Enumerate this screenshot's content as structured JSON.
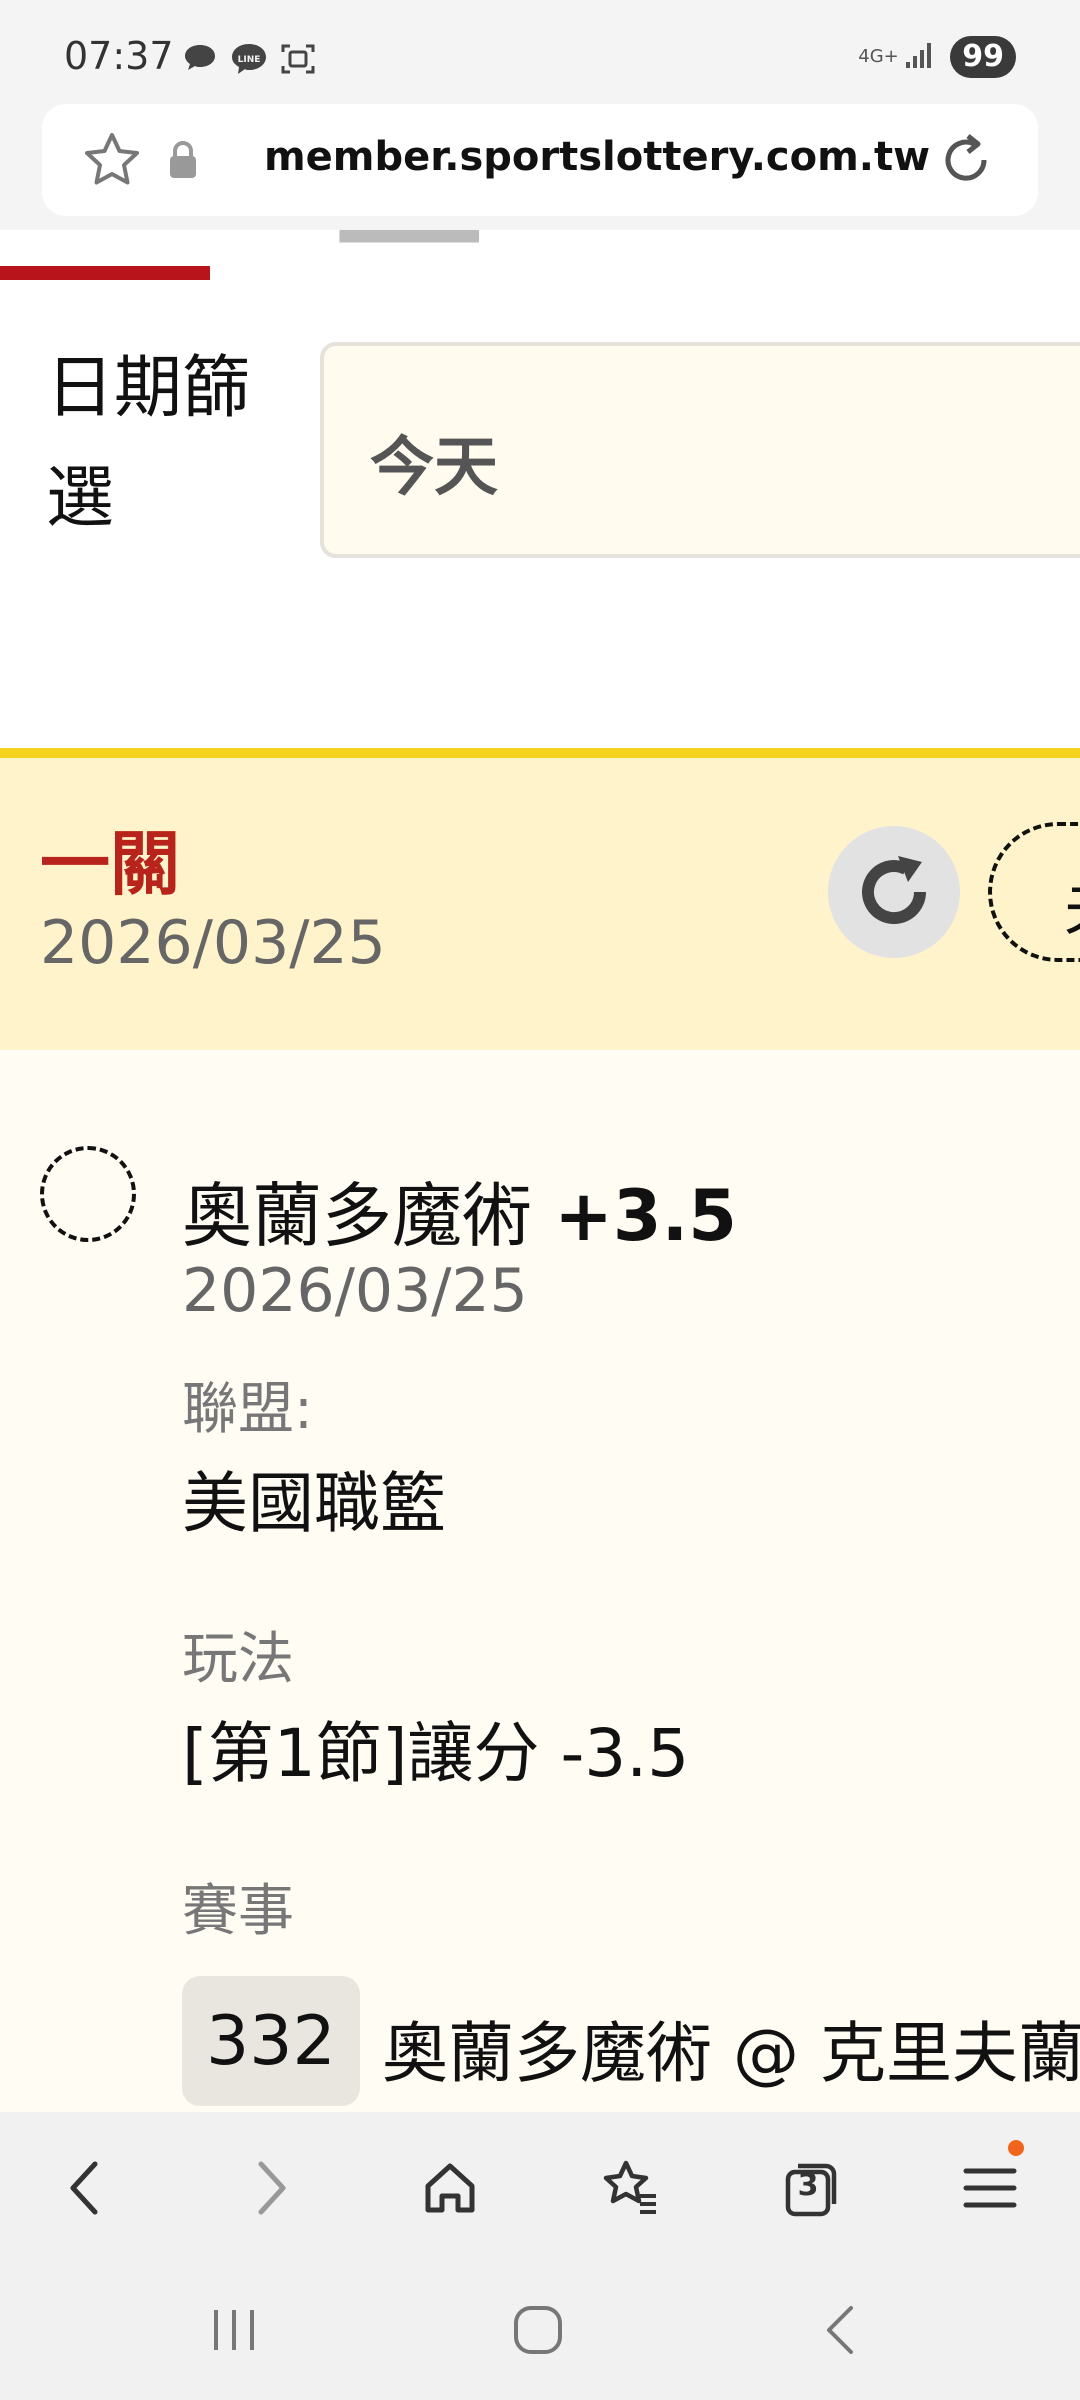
{
  "status_bar": {
    "time": "07:37",
    "network_label": "4G+",
    "battery": "99",
    "icons": [
      "chat-bubble-icon",
      "line-app-icon",
      "screenshot-icon",
      "signal-icon"
    ]
  },
  "url_bar": {
    "url": "member.sportslottery.com.tw"
  },
  "filter": {
    "date_label": "日期篩選",
    "date_value": "今天"
  },
  "section": {
    "title": "一關",
    "date": "2026/03/25",
    "right_button_partial": "夫"
  },
  "bet": {
    "team": "奧蘭多魔術",
    "handicap": "+3.5",
    "date": "2026/03/25",
    "league_label": "聯盟:",
    "league_value": "美國職籃",
    "play_label": "玩法",
    "play_value": "[第1節]讓分 -3.5",
    "event_label": "賽事",
    "game_number": "332",
    "game_name": "奧蘭多魔術 @ 克里夫蘭"
  },
  "browser_toolbar": {
    "tabs_count": "3",
    "icons": [
      "back-icon",
      "forward-icon",
      "home-icon",
      "bookmarks-icon",
      "tabs-icon",
      "menu-icon"
    ]
  },
  "system_nav": {
    "icons": [
      "recent-apps-icon",
      "home-circle-icon",
      "system-back-icon"
    ]
  },
  "colors": {
    "accent_red": "#b8141c",
    "highlight_yellow": "#f5d21e",
    "section_bg": "#fff3cb",
    "notification_orange": "#f0651e"
  }
}
